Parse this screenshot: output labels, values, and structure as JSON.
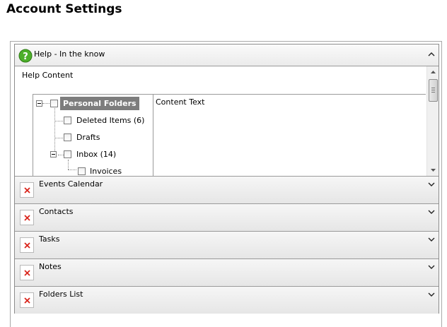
{
  "page": {
    "title": "Account Settings"
  },
  "panes": [
    {
      "title": "Help - In the know",
      "icon": "help-icon",
      "expanded": true
    },
    {
      "title": "Events Calendar",
      "icon": "broken-image-icon",
      "expanded": false
    },
    {
      "title": "Contacts",
      "icon": "broken-image-icon",
      "expanded": false
    },
    {
      "title": "Tasks",
      "icon": "broken-image-icon",
      "expanded": false
    },
    {
      "title": "Notes",
      "icon": "broken-image-icon",
      "expanded": false
    },
    {
      "title": "Folders List",
      "icon": "broken-image-icon",
      "expanded": false
    }
  ],
  "help": {
    "content_label": "Help Content",
    "content_text": "Content Text",
    "tree": [
      {
        "label": "Personal Folders",
        "selected": true
      },
      {
        "label": "Deleted Items (6)",
        "selected": false
      },
      {
        "label": "Drafts",
        "selected": false
      },
      {
        "label": "Inbox (14)",
        "selected": false
      },
      {
        "label": "Invoices",
        "selected": false
      }
    ]
  },
  "colors": {
    "selected_node_bg": "#7d7d7d",
    "help_icon": "#4caf2a",
    "broken_image_x": "#d9261c"
  }
}
